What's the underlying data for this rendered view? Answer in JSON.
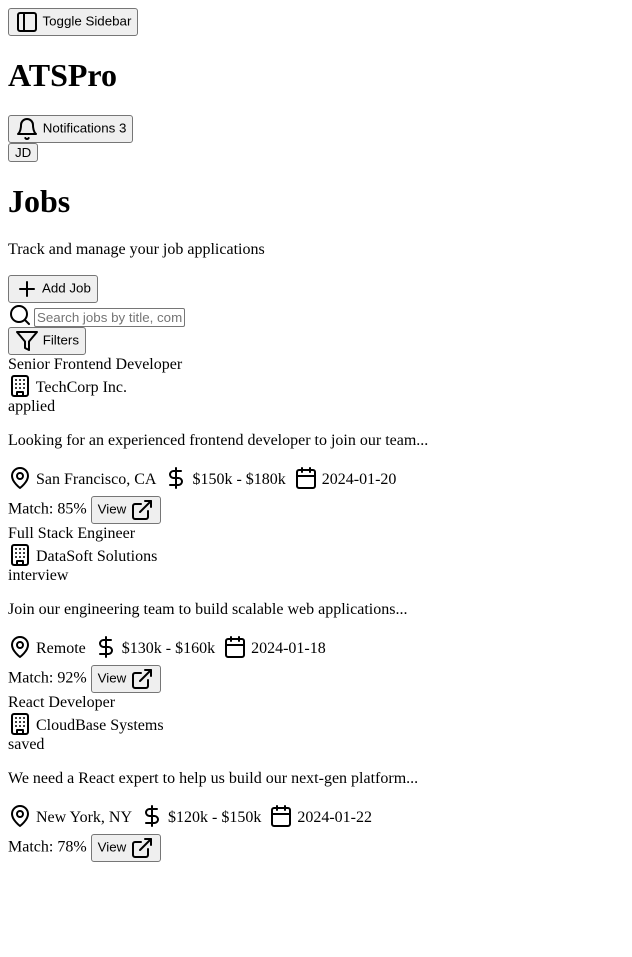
{
  "header": {
    "toggle_label": "Toggle Sidebar",
    "app_title": "ATSPro",
    "notifications_label": "Notifications",
    "notifications_count": "3",
    "avatar_initials": "JD"
  },
  "main": {
    "page_title": "Jobs",
    "subtitle": "Track and manage your job applications",
    "add_job_label": "Add Job",
    "search_placeholder": "Search jobs by title, company...",
    "filters_label": "Filters"
  },
  "jobs": [
    {
      "title": "Senior Frontend Developer",
      "company": "TechCorp Inc.",
      "status": "applied",
      "description": "Looking for an experienced frontend developer to join our team...",
      "location": "San Francisco, CA",
      "salary": "$150k - $180k",
      "date": "2024-01-20",
      "match": "Match: 85%",
      "view_label": "View"
    },
    {
      "title": "Full Stack Engineer",
      "company": "DataSoft Solutions",
      "status": "interview",
      "description": "Join our engineering team to build scalable web applications...",
      "location": "Remote",
      "salary": "$130k - $160k",
      "date": "2024-01-18",
      "match": "Match: 92%",
      "view_label": "View"
    },
    {
      "title": "React Developer",
      "company": "CloudBase Systems",
      "status": "saved",
      "description": "We need a React expert to help us build our next-gen platform...",
      "location": "New York, NY",
      "salary": "$120k - $150k",
      "date": "2024-01-22",
      "match": "Match: 78%",
      "view_label": "View"
    }
  ]
}
